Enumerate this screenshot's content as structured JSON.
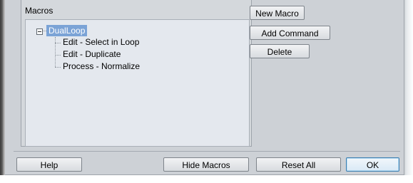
{
  "macros": {
    "title": "Macros",
    "tree": {
      "root": "DualLoop",
      "children": [
        "Edit - Select in Loop",
        "Edit - Duplicate",
        "Process - Normalize"
      ]
    }
  },
  "side_buttons": {
    "new_macro": "New Macro",
    "add_command": "Add Command",
    "delete": "Delete"
  },
  "footer": {
    "help": "Help",
    "hide_macros": "Hide Macros",
    "reset_all": "Reset All",
    "ok": "OK"
  },
  "colors": {
    "dialog_bg": "#cdd1d6",
    "tree_bg": "#e4e8ee",
    "selection": "#7ba3d6",
    "ok_border": "#3c7fb1"
  }
}
